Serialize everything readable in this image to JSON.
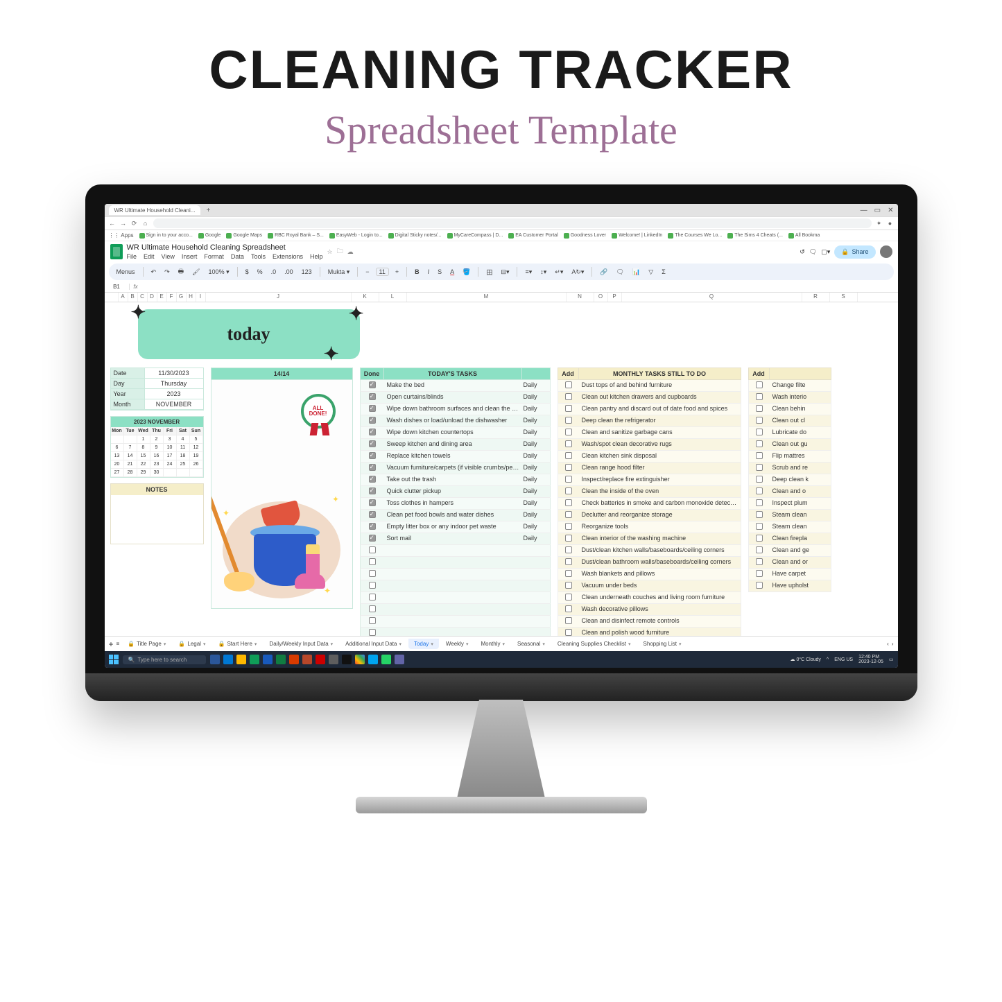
{
  "hero": {
    "title": "CLEANING TRACKER",
    "subtitle": "Spreadsheet Template"
  },
  "browser": {
    "tab_title": "WR Ultimate Household Cleani...",
    "bookmarks": [
      "Sign in to your acco...",
      "Google",
      "Google Maps",
      "RBC Royal Bank – S...",
      "EasyWeb - Login to...",
      "Digital Sticky notes/...",
      "MyCareCompass | D...",
      "EA Customer Portal",
      "Goodness Lover",
      "Welcome! | LinkedIn",
      "The Courses We Lo...",
      "The Sims 4 Cheats (...",
      "All Bookma"
    ]
  },
  "sheets": {
    "doc_title": "WR Ultimate Household Cleaning Spreadsheet",
    "menus": [
      "File",
      "Edit",
      "View",
      "Insert",
      "Format",
      "Data",
      "Tools",
      "Extensions",
      "Help"
    ],
    "share": "Share",
    "toolbar": {
      "menus": "Menus",
      "zoom": "100%",
      "font": "Mukta",
      "size": "11"
    },
    "namebox": "B1",
    "columns": [
      "A",
      "B",
      "C",
      "D",
      "E",
      "F",
      "G",
      "H",
      "I",
      "J",
      "K",
      "L",
      "M",
      "N",
      "O",
      "P",
      "Q",
      "R",
      "S"
    ]
  },
  "banner": {
    "label": "today"
  },
  "info": {
    "date_label": "Date",
    "date_value": "11/30/2023",
    "day_label": "Day",
    "day_value": "Thursday",
    "year_label": "Year",
    "year_value": "2023",
    "month_label": "Month",
    "month_value": "NOVEMBER"
  },
  "calendar": {
    "title": "2023 NOVEMBER",
    "dow": [
      "Mon",
      "Tue",
      "Wed",
      "Thu",
      "Fri",
      "Sat",
      "Sun"
    ],
    "cells": [
      "",
      "",
      "1",
      "2",
      "3",
      "4",
      "5",
      "6",
      "7",
      "8",
      "9",
      "10",
      "11",
      "12",
      "13",
      "14",
      "15",
      "16",
      "17",
      "18",
      "19",
      "20",
      "21",
      "22",
      "23",
      "24",
      "25",
      "26",
      "27",
      "28",
      "29",
      "30",
      "",
      "",
      ""
    ]
  },
  "notes": {
    "title": "NOTES"
  },
  "illus": {
    "counter": "14/14",
    "badge_l1": "ALL",
    "badge_l2": "DONE!"
  },
  "today_tasks": {
    "h_done": "Done",
    "h_title": "TODAY'S TASKS",
    "h_blank": "",
    "rows": [
      {
        "done": true,
        "task": "Make the bed",
        "freq": "Daily"
      },
      {
        "done": true,
        "task": "Open curtains/blinds",
        "freq": "Daily"
      },
      {
        "done": true,
        "task": "Wipe down bathroom surfaces and clean the toilet",
        "freq": "Daily"
      },
      {
        "done": true,
        "task": "Wash dishes or load/unload the dishwasher",
        "freq": "Daily"
      },
      {
        "done": true,
        "task": "Wipe down kitchen countertops",
        "freq": "Daily"
      },
      {
        "done": true,
        "task": "Sweep kitchen and dining area",
        "freq": "Daily"
      },
      {
        "done": true,
        "task": "Replace kitchen towels",
        "freq": "Daily"
      },
      {
        "done": true,
        "task": "Vacuum furniture/carpets (if visible crumbs/pet hair etc)",
        "freq": "Daily"
      },
      {
        "done": true,
        "task": "Take out the trash",
        "freq": "Daily"
      },
      {
        "done": true,
        "task": "Quick clutter pickup",
        "freq": "Daily"
      },
      {
        "done": true,
        "task": "Toss clothes in hampers",
        "freq": "Daily"
      },
      {
        "done": true,
        "task": "Clean pet food bowls and water dishes",
        "freq": "Daily"
      },
      {
        "done": true,
        "task": "Empty litter box or any indoor pet waste",
        "freq": "Daily"
      },
      {
        "done": true,
        "task": "Sort mail",
        "freq": "Daily"
      }
    ],
    "empty_rows": 12
  },
  "monthly": {
    "h_add": "Add",
    "h_title": "MONTHLY TASKS STILL TO DO",
    "rows": [
      "Dust tops of and behind furniture",
      "Clean out kitchen drawers and cupboards",
      "Clean pantry and discard out of date food and spices",
      "Deep clean the refrigerator",
      "Clean and sanitize garbage cans",
      "Wash/spot clean decorative rugs",
      "Clean kitchen sink disposal",
      "Clean range hood filter",
      "Inspect/replace fire extinguisher",
      "Clean the inside of the oven",
      "Check batteries in smoke and carbon monoxide detectors",
      "Declutter and reorganize storage",
      "Reorganize tools",
      "Clean interior of the washing machine",
      "Dust/clean kitchen walls/baseboards/ceiling corners",
      "Dust/clean bathroom walls/baseboards/ceiling corners",
      "Wash blankets and pillows",
      "Vacuum under beds",
      "Clean underneath couches and living room furniture",
      "Wash decorative pillows",
      "Clean and disinfect remote controls",
      "Clean and polish wood furniture"
    ]
  },
  "extra": {
    "h_add": "Add",
    "rows": [
      "Change filte",
      "Wash interio",
      "Clean behin",
      "Clean out cl",
      "Lubricate do",
      "Clean out gu",
      "Flip mattres",
      "Scrub and re",
      "Deep clean k",
      "Clean and o",
      "Inspect plum",
      "Steam clean",
      "Steam clean",
      "Clean firepla",
      "Clean and ge",
      "Clean and or",
      "Have carpet",
      "Have upholst"
    ]
  },
  "sheet_tabs": {
    "tabs": [
      {
        "label": "Title Page",
        "locked": true
      },
      {
        "label": "Legal",
        "locked": true
      },
      {
        "label": "Start Here",
        "locked": true
      },
      {
        "label": "Daily/Weekly Input Data"
      },
      {
        "label": "Additional Input Data"
      },
      {
        "label": "Today",
        "active": true
      },
      {
        "label": "Weekly"
      },
      {
        "label": "Monthly"
      },
      {
        "label": "Seasonal"
      },
      {
        "label": "Cleaning Supplies Checklist"
      },
      {
        "label": "Shopping List"
      }
    ]
  },
  "taskbar": {
    "search": "Type here to search",
    "weather": "0°C  Cloudy",
    "lang": "ENG US",
    "time": "12:40 PM",
    "date": "2023-12-05"
  }
}
